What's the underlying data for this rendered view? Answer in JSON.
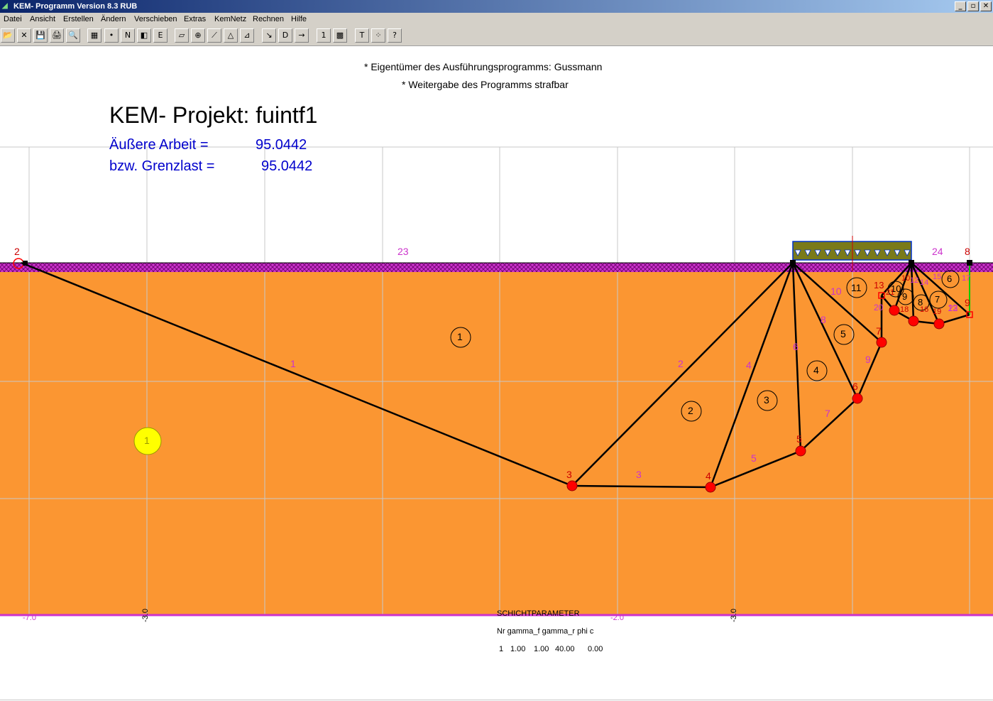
{
  "window": {
    "title": "KEM- Programm Version 8.3 RUB",
    "controls": [
      "_",
      "▫",
      "✕"
    ]
  },
  "menu": [
    "Datei",
    "Ansicht",
    "Erstellen",
    "Ändern",
    "Verschieben",
    "Extras",
    "KemNetz",
    "Rechnen",
    "Hilfe"
  ],
  "toolbar": [
    {
      "name": "open-icon",
      "glyph": "📂"
    },
    {
      "name": "close-file-icon",
      "glyph": "✕"
    },
    {
      "name": "save-icon",
      "glyph": "💾"
    },
    {
      "name": "print-icon",
      "glyph": "🖨"
    },
    {
      "name": "print-preview-icon",
      "glyph": "🔍"
    },
    {
      "name": "grid-icon",
      "glyph": "▦"
    },
    {
      "name": "node-icon",
      "glyph": "•"
    },
    {
      "name": "no-entry-icon",
      "glyph": "N"
    },
    {
      "name": "layer-icon",
      "glyph": "◧"
    },
    {
      "name": "edit-e-icon",
      "glyph": "E"
    },
    {
      "name": "parallelogram-icon",
      "glyph": "▱"
    },
    {
      "name": "zoom-icon",
      "glyph": "⊕"
    },
    {
      "name": "line-icon",
      "glyph": "⟋"
    },
    {
      "name": "triangle-icon",
      "glyph": "△"
    },
    {
      "name": "triangle-x-icon",
      "glyph": "⊿"
    },
    {
      "name": "arrow-down-right-icon",
      "glyph": "↘"
    },
    {
      "name": "d-arrow-icon",
      "glyph": "D"
    },
    {
      "name": "arrow-right-icon",
      "glyph": "→"
    },
    {
      "name": "one-icon",
      "glyph": "1"
    },
    {
      "name": "matrix-icon",
      "glyph": "▩"
    },
    {
      "name": "text-icon",
      "glyph": "T"
    },
    {
      "name": "dots-icon",
      "glyph": "⁘"
    },
    {
      "name": "help-icon",
      "glyph": "?"
    }
  ],
  "header": {
    "line1": "* Eigentümer des Ausführungsprogramms: Gussmann",
    "line2": "* Weitergabe des Programms strafbar"
  },
  "project": {
    "title": "KEM- Projekt: fuintf1"
  },
  "results": {
    "work_label": "Äußere Arbeit =",
    "work_value": "95.0442",
    "limit_label": "bzw. Grenzlast =",
    "limit_value": "95.0442"
  },
  "axis": {
    "labels": [
      "-7.0",
      "-3.0",
      "-2.0",
      "-3.0"
    ]
  },
  "parameters": {
    "title": "SCHICHTPARAMETER",
    "header": "Nr gamma_f gamma_r phi c",
    "row": [
      "1",
      "1.00",
      "1.00",
      "40.00",
      "0.00"
    ]
  },
  "mesh": {
    "node_labels": [
      "2",
      "3",
      "4",
      "5",
      "6",
      "7",
      "8",
      "9",
      "13",
      "23",
      "24",
      "10",
      "12",
      "14",
      "15",
      "16",
      "17",
      "18",
      "19",
      "20",
      "21",
      "22"
    ],
    "line_labels": [
      "1",
      "2",
      "3",
      "4",
      "5",
      "6",
      "7",
      "8",
      "9",
      "10",
      "13"
    ],
    "body_labels": [
      "1",
      "2",
      "3",
      "4",
      "5",
      "6",
      "7",
      "8",
      "9",
      "10",
      "11"
    ],
    "layer_label": "1"
  },
  "colors": {
    "soil": "#fb9632",
    "surface": "#cc33cc",
    "load": "#7a7a1a",
    "node": "#ff0000",
    "label": "#cc33cc",
    "node_label": "#cc0000",
    "grid": "#c8c8c8"
  }
}
